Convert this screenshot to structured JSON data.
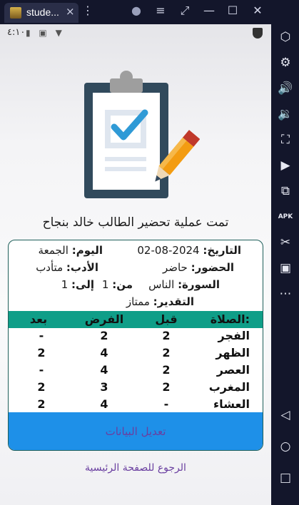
{
  "emulator": {
    "tab_title": "stude...",
    "tab_close": "×",
    "buttons": {
      "menu": "⋮",
      "account": "●",
      "hamburger": "≡",
      "expand": "⤢",
      "minimize": "—",
      "maximize": "☐",
      "close": "✕"
    },
    "sidebar": [
      "⬡",
      "⚙",
      "🔊",
      "🔉",
      "⛶",
      "▶",
      "⧉",
      "APK",
      "✂",
      "▣",
      "⋯",
      "◁",
      "○",
      "□"
    ]
  },
  "status_bar": {
    "time": "٤:١٠",
    "icons": "▮ ▣ ▼"
  },
  "message": "تمت عملية تحضير الطالب خالد بنجاح",
  "info": {
    "date_label": "التاريخ:",
    "date_value": "2024-08-02",
    "day_label": "اليوم:",
    "day_value": "الجمعة",
    "attendance_label": "الحضور:",
    "attendance_value": "حاضر",
    "manners_label": "الأدب:",
    "manners_value": "متأدب",
    "surah_label": "السورة:",
    "surah_value": "الناس",
    "from_label": "من:",
    "from_value": "1",
    "to_label": "إلى:",
    "to_value": "1",
    "grade_label": "التقدير:",
    "grade_value": "ممتاز"
  },
  "table": {
    "headers": {
      "prayer": "الصلاة:",
      "before": "قبل",
      "fard": "الفرض",
      "after": "بعد"
    },
    "rows": [
      {
        "prayer": "الفجر",
        "before": "2",
        "fard": "2",
        "after": "-"
      },
      {
        "prayer": "الظهر",
        "before": "2",
        "fard": "4",
        "after": "2"
      },
      {
        "prayer": "العصر",
        "before": "2",
        "fard": "4",
        "after": "-"
      },
      {
        "prayer": "المغرب",
        "before": "2",
        "fard": "3",
        "after": "2"
      },
      {
        "prayer": "العشاء",
        "before": "-",
        "fard": "4",
        "after": "2"
      }
    ]
  },
  "edit_button": "تعديل البيانات",
  "home_link": "الرجوع للصفحة الرئيسية",
  "colors": {
    "table_header": "#0f9e88",
    "button": "#1e90e8",
    "link": "#6a3fa0"
  }
}
